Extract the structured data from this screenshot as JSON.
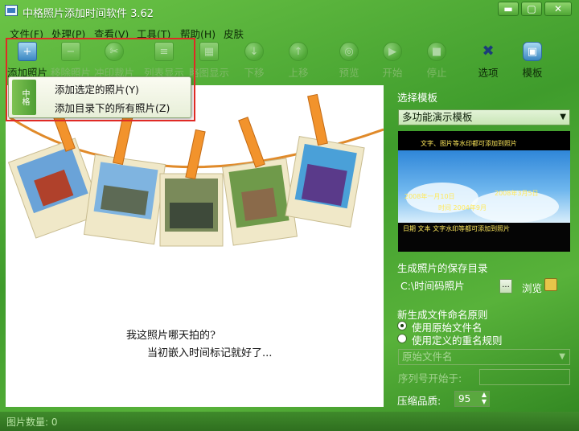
{
  "window": {
    "title": "中格照片添加时间软件 3.62",
    "buttons": [
      "▬",
      "▢",
      "✕"
    ]
  },
  "menu": [
    "文件(F)",
    "处理(P)",
    "查看(V)",
    "工具(T)",
    "帮助(H)",
    "皮肤"
  ],
  "toolbar": [
    {
      "label": "添加照片",
      "icon": "add-photo-icon"
    },
    {
      "label": "移除照片",
      "icon": "remove-photo-icon"
    },
    {
      "label": "冲印裁片",
      "icon": "crop-print-icon"
    },
    {
      "label": "列表显示",
      "icon": "list-view-icon"
    },
    {
      "label": "略图显示",
      "icon": "thumbnail-view-icon"
    },
    {
      "label": "下移",
      "icon": "move-down-icon"
    },
    {
      "label": "上移",
      "icon": "move-up-icon"
    },
    {
      "label": "预览",
      "icon": "preview-icon"
    },
    {
      "label": "开始",
      "icon": "start-icon"
    },
    {
      "label": "停止",
      "icon": "stop-icon"
    },
    {
      "label": "选项",
      "icon": "options-icon"
    },
    {
      "label": "模板",
      "icon": "template-icon"
    }
  ],
  "add_menu": {
    "strip_text": "中格",
    "items": [
      "添加选定的照片(Y)",
      "添加目录下的所有照片(Z)"
    ]
  },
  "canvas": {
    "caption_line1": "我这照片哪天拍的?",
    "caption_line2": "当初嵌入时间标记就好了..."
  },
  "right_panel": {
    "template_label": "选择模板",
    "template_value": "多功能演示模板",
    "preview_texts": [
      "文字、图片等水印都可添加到照片",
      "2008年一月10日",
      "2008年3月5日",
      "时间 2004年9月",
      "日期 文本 文字水印等都可添加到照片"
    ],
    "save_dir_label": "生成照片的保存目录",
    "save_dir_value": "C:\\时间码照片",
    "dots_label": "...",
    "browse_label": "浏览",
    "naming_label": "新生成文件命名原则",
    "naming_options": [
      "使用原始文件名",
      "使用定义的重名规则"
    ],
    "naming_selected": 0,
    "rename_select": "原始文件名",
    "seq_label": "序列号开始于:",
    "quality_label": "压缩品质:",
    "quality_value": "95"
  },
  "status": {
    "photo_count_label": "图片数量: 0"
  },
  "colors": {
    "accent_red": "#e02a25",
    "window_green": "#4ea436"
  }
}
